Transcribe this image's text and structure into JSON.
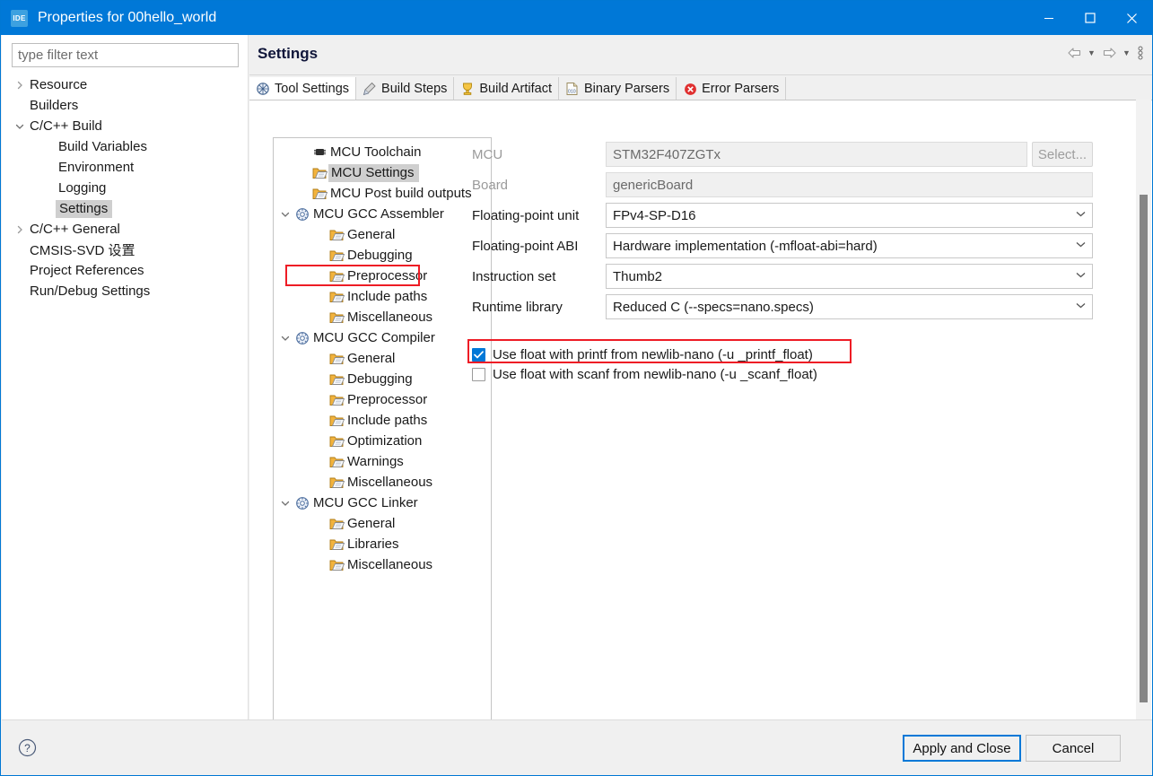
{
  "window": {
    "title": "Properties for 00hello_world",
    "app_icon_text": "IDE",
    "titlebar_color": "#0078d7",
    "minimize_label": "—",
    "maximize_label": "☐",
    "close_label": "✕"
  },
  "filter": {
    "placeholder": "type filter text",
    "value": ""
  },
  "nav_tree": [
    {
      "label": "Resource",
      "indent": 0,
      "arrow": "collapsed",
      "selected": false
    },
    {
      "label": "Builders",
      "indent": 0,
      "arrow": "none",
      "selected": false
    },
    {
      "label": "C/C++ Build",
      "indent": 0,
      "arrow": "expanded",
      "selected": false
    },
    {
      "label": "Build Variables",
      "indent": 1,
      "arrow": "none",
      "selected": false
    },
    {
      "label": "Environment",
      "indent": 1,
      "arrow": "none",
      "selected": false
    },
    {
      "label": "Logging",
      "indent": 1,
      "arrow": "none",
      "selected": false
    },
    {
      "label": "Settings",
      "indent": 1,
      "arrow": "none",
      "selected": true
    },
    {
      "label": "C/C++ General",
      "indent": 0,
      "arrow": "collapsed",
      "selected": false
    },
    {
      "label": "CMSIS-SVD 设置",
      "indent": 0,
      "arrow": "none",
      "selected": false
    },
    {
      "label": "Project References",
      "indent": 0,
      "arrow": "none",
      "selected": false
    },
    {
      "label": "Run/Debug Settings",
      "indent": 0,
      "arrow": "none",
      "selected": false
    }
  ],
  "header": {
    "title": "Settings",
    "back_icon": "back-arrow-icon",
    "forward_icon": "forward-arrow-icon",
    "menu_icon": "view-menu-icon"
  },
  "tabs": [
    {
      "label": "Tool Settings",
      "icon": "tool-settings-icon",
      "active": true
    },
    {
      "label": "Build Steps",
      "icon": "build-steps-icon",
      "active": false
    },
    {
      "label": "Build Artifact",
      "icon": "build-artifact-icon",
      "active": false
    },
    {
      "label": "Binary Parsers",
      "icon": "binary-parsers-icon",
      "active": false
    },
    {
      "label": "Error Parsers",
      "icon": "error-parsers-icon",
      "active": false
    }
  ],
  "mcu_tree": [
    {
      "label": "MCU Toolchain",
      "indent": 1,
      "arrow": "none",
      "icon": "chip-icon",
      "selected": false
    },
    {
      "label": "MCU Settings",
      "indent": 1,
      "arrow": "none",
      "icon": "folder-icon",
      "selected": true
    },
    {
      "label": "MCU Post build outputs",
      "indent": 1,
      "arrow": "none",
      "icon": "folder-icon",
      "selected": false
    },
    {
      "label": "MCU GCC Assembler",
      "indent": 0,
      "arrow": "expanded",
      "icon": "gear-icon",
      "selected": false
    },
    {
      "label": "General",
      "indent": 2,
      "arrow": "none",
      "icon": "folder-icon",
      "selected": false
    },
    {
      "label": "Debugging",
      "indent": 2,
      "arrow": "none",
      "icon": "folder-icon",
      "selected": false
    },
    {
      "label": "Preprocessor",
      "indent": 2,
      "arrow": "none",
      "icon": "folder-icon",
      "selected": false
    },
    {
      "label": "Include paths",
      "indent": 2,
      "arrow": "none",
      "icon": "folder-icon",
      "selected": false
    },
    {
      "label": "Miscellaneous",
      "indent": 2,
      "arrow": "none",
      "icon": "folder-icon",
      "selected": false
    },
    {
      "label": "MCU GCC Compiler",
      "indent": 0,
      "arrow": "expanded",
      "icon": "gear-icon",
      "selected": false
    },
    {
      "label": "General",
      "indent": 2,
      "arrow": "none",
      "icon": "folder-icon",
      "selected": false
    },
    {
      "label": "Debugging",
      "indent": 2,
      "arrow": "none",
      "icon": "folder-icon",
      "selected": false
    },
    {
      "label": "Preprocessor",
      "indent": 2,
      "arrow": "none",
      "icon": "folder-icon",
      "selected": false
    },
    {
      "label": "Include paths",
      "indent": 2,
      "arrow": "none",
      "icon": "folder-icon",
      "selected": false
    },
    {
      "label": "Optimization",
      "indent": 2,
      "arrow": "none",
      "icon": "folder-icon",
      "selected": false
    },
    {
      "label": "Warnings",
      "indent": 2,
      "arrow": "none",
      "icon": "folder-icon",
      "selected": false
    },
    {
      "label": "Miscellaneous",
      "indent": 2,
      "arrow": "none",
      "icon": "folder-icon",
      "selected": false
    },
    {
      "label": "MCU GCC Linker",
      "indent": 0,
      "arrow": "expanded",
      "icon": "gear-icon",
      "selected": false
    },
    {
      "label": "General",
      "indent": 2,
      "arrow": "none",
      "icon": "folder-icon",
      "selected": false
    },
    {
      "label": "Libraries",
      "indent": 2,
      "arrow": "none",
      "icon": "folder-icon",
      "selected": false
    },
    {
      "label": "Miscellaneous",
      "indent": 2,
      "arrow": "none",
      "icon": "folder-icon",
      "selected": false
    }
  ],
  "form": {
    "rows": [
      {
        "label": "MCU",
        "value": "STM32F407ZGTx",
        "kind": "text-with-button",
        "disabled": true
      },
      {
        "label": "Board",
        "value": "genericBoard",
        "kind": "text",
        "disabled": true
      },
      {
        "label": "Floating-point unit",
        "value": "FPv4-SP-D16",
        "kind": "combo",
        "disabled": false
      },
      {
        "label": "Floating-point ABI",
        "value": "Hardware implementation (-mfloat-abi=hard)",
        "kind": "combo",
        "disabled": false
      },
      {
        "label": "Instruction set",
        "value": "Thumb2",
        "kind": "combo",
        "disabled": false
      },
      {
        "label": "Runtime library",
        "value": "Reduced C (--specs=nano.specs)",
        "kind": "combo",
        "disabled": false
      }
    ],
    "select_button_label": "Select..."
  },
  "checkboxes": [
    {
      "label": "Use float with printf from newlib-nano (-u _printf_float)",
      "checked": true,
      "highlighted": true
    },
    {
      "label": "Use float with scanf from newlib-nano (-u _scanf_float)",
      "checked": false,
      "highlighted": false
    }
  ],
  "highlight_color": "#ee1c25",
  "footer": {
    "help_icon": "help-question-icon",
    "apply_label": "Apply and Close",
    "cancel_label": "Cancel"
  }
}
